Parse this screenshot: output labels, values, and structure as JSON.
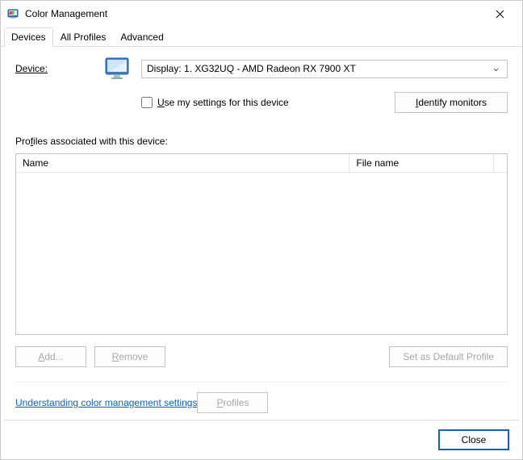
{
  "window": {
    "title": "Color Management"
  },
  "tabs": [
    "Devices",
    "All Profiles",
    "Advanced"
  ],
  "active_tab": 0,
  "device": {
    "label_pre": "D",
    "label_post": "evice:",
    "selected": "Display: 1. XG32UQ - AMD Radeon RX 7900 XT",
    "use_my_settings_pre": "U",
    "use_my_settings_post": "se my settings for this device",
    "use_my_settings_checked": false,
    "identify_btn_pre": "I",
    "identify_btn_post": "dentify monitors"
  },
  "profiles": {
    "section_label_pre": "Pro",
    "section_label_mid": "f",
    "section_label_post": "iles associated with this device:",
    "columns": {
      "name": "Name",
      "file": "File name"
    },
    "rows": []
  },
  "buttons": {
    "add_pre": "A",
    "add_post": "dd...",
    "remove_pre": "R",
    "remove_post": "emove",
    "set_default": "Set as Default Profile",
    "profiles_pre": "P",
    "profiles_post": "rofiles",
    "close": "Close"
  },
  "link": {
    "text": "Understanding color management settings"
  }
}
